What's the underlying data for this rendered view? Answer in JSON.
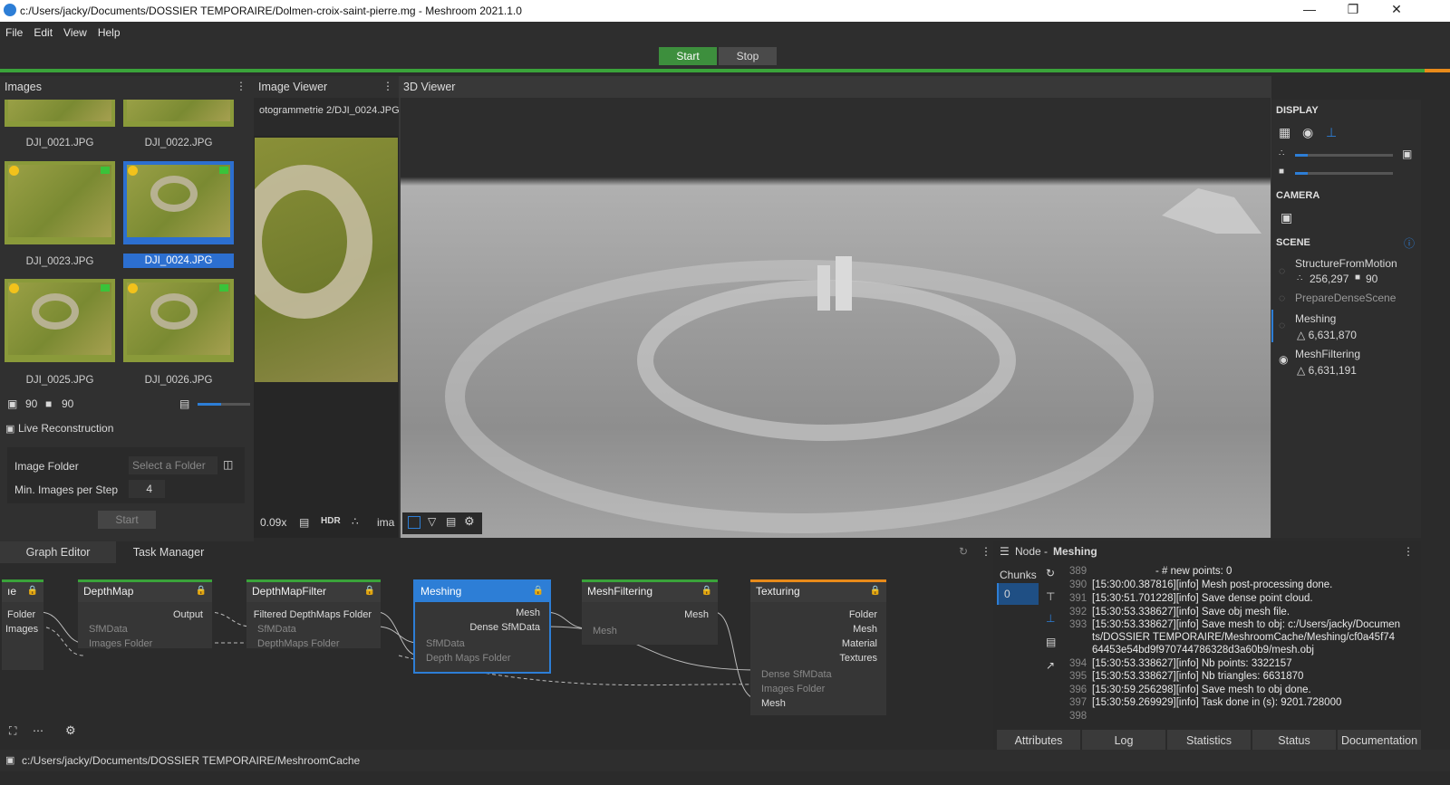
{
  "window": {
    "title": "c:/Users/jacky/Documents/DOSSIER TEMPORAIRE/Dolmen-croix-saint-pierre.mg - Meshroom 2021.1.0"
  },
  "menu": [
    "File",
    "Edit",
    "View",
    "Help"
  ],
  "toolbar": {
    "start": "Start",
    "stop": "Stop"
  },
  "images_panel": {
    "title": "Images",
    "thumbs": [
      {
        "name": "DJI_0021.JPG"
      },
      {
        "name": "DJI_0022.JPG"
      },
      {
        "name": "DJI_0023.JPG"
      },
      {
        "name": "DJI_0024.JPG"
      },
      {
        "name": "DJI_0025.JPG"
      },
      {
        "name": "DJI_0026.JPG"
      }
    ],
    "image_count": "90",
    "camera_count": "90",
    "live_reconstruction": "Live Reconstruction",
    "image_folder_label": "Image Folder",
    "image_folder_placeholder": "Select a Folder",
    "min_images_label": "Min. Images per Step",
    "min_images_value": "4",
    "start": "Start"
  },
  "image_viewer": {
    "title": "Image Viewer",
    "path": "otogrammetrie 2/DJI_0024.JPG",
    "zoom": "0.09x",
    "hdr": "HDR",
    "ima": "ima"
  },
  "viewer3d": {
    "title": "3D Viewer"
  },
  "right_panel": {
    "display": "DISPLAY",
    "camera": "CAMERA",
    "scene": "SCENE",
    "items": [
      {
        "name": "StructureFromMotion",
        "stats": "256,297",
        "stats2": "90"
      },
      {
        "name": "PrepareDenseScene",
        "stats": ""
      },
      {
        "name": "Meshing",
        "stats": "△ 6,631,870"
      },
      {
        "name": "MeshFiltering",
        "stats": "△ 6,631,191"
      }
    ]
  },
  "graph": {
    "tabs": [
      "Graph Editor",
      "Task Manager"
    ],
    "nodes": {
      "prev": {
        "title": "ıe",
        "ports": [
          "Folder",
          "Images"
        ]
      },
      "depthmap": {
        "title": "DepthMap",
        "out": "Output",
        "in1": "SfMData",
        "in2": "Images Folder"
      },
      "depthmapfilter": {
        "title": "DepthMapFilter",
        "out": "Filtered DepthMaps Folder",
        "in1": "SfMData",
        "in2": "DepthMaps Folder"
      },
      "meshing": {
        "title": "Meshing",
        "out1": "Mesh",
        "out2": "Dense SfMData",
        "in1": "SfMData",
        "in2": "Depth Maps Folder"
      },
      "meshfiltering": {
        "title": "MeshFiltering",
        "out": "Mesh",
        "in1": "Mesh"
      },
      "texturing": {
        "title": "Texturing",
        "out1": "Folder",
        "out2": "Mesh",
        "out3": "Material",
        "out4": "Textures",
        "in1": "Dense SfMData",
        "in2": "Images Folder",
        "in3": "Mesh"
      }
    }
  },
  "node_panel": {
    "label": "Node - ",
    "node_name": "Meshing",
    "chunks": "Chunks",
    "chunk0": "0",
    "log": [
      {
        "n": "389",
        "t": "- # new points: 0"
      },
      {
        "n": "390",
        "t": "[15:30:00.387816][info] Mesh post-processing done."
      },
      {
        "n": "391",
        "t": "[15:30:51.701228][info] Save dense point cloud."
      },
      {
        "n": "392",
        "t": "[15:30:53.338627][info] Save obj mesh file."
      },
      {
        "n": "393",
        "t": "[15:30:53.338627][info] Save mesh to obj: c:/Users/jacky/Documen"
      },
      {
        "n": "",
        "t": "ts/DOSSIER TEMPORAIRE/MeshroomCache/Meshing/cf0a45f74"
      },
      {
        "n": "",
        "t": "64453e54bd9f970744786328d3a60b9/mesh.obj"
      },
      {
        "n": "394",
        "t": "[15:30:53.338627][info] Nb points: 3322157"
      },
      {
        "n": "395",
        "t": "[15:30:53.338627][info] Nb triangles: 6631870"
      },
      {
        "n": "396",
        "t": "[15:30:59.256298][info] Save mesh to obj done."
      },
      {
        "n": "397",
        "t": "[15:30:59.269929][info] Task done in (s): 9201.728000"
      },
      {
        "n": "398",
        "t": ""
      }
    ],
    "tabs": [
      "Attributes",
      "Log",
      "Statistics",
      "Status",
      "Documentation"
    ]
  },
  "status_path": "c:/Users/jacky/Documents/DOSSIER TEMPORAIRE/MeshroomCache"
}
